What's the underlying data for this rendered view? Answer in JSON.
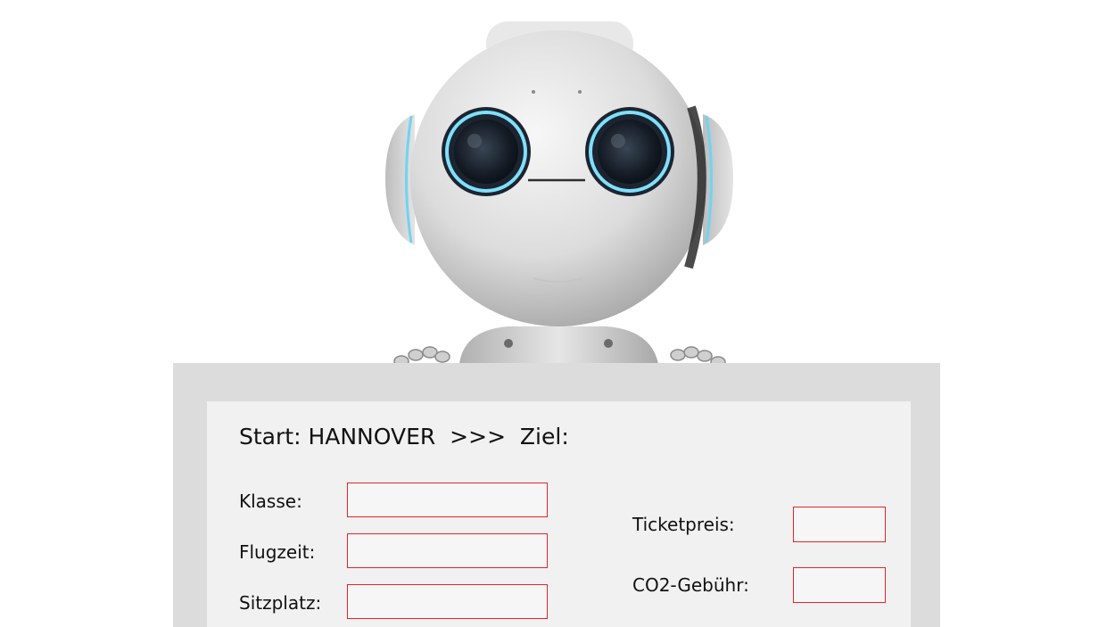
{
  "route": {
    "start_label": "Start:",
    "start_value": "HANNOVER",
    "arrow": ">>>",
    "destination_label": "Ziel:"
  },
  "form": {
    "left_fields": [
      {
        "label": "Klasse:"
      },
      {
        "label": "Flugzeit:"
      },
      {
        "label": "Sitzplatz:"
      }
    ],
    "right_fields": [
      {
        "label": "Ticketpreis:"
      },
      {
        "label": "CO2-Gebühr:"
      }
    ]
  },
  "colors": {
    "field_border": "#e6232a",
    "board": "#dcdcdc",
    "panel": "#f1f1f1"
  }
}
